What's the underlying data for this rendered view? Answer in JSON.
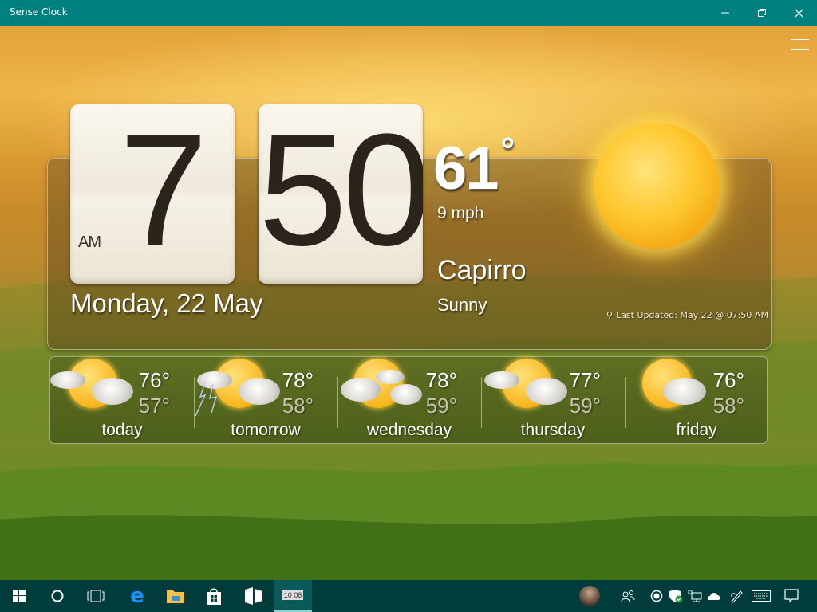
{
  "window": {
    "title": "Sense Clock",
    "minimize_icon": "minimize-icon",
    "maximize_icon": "restore-icon",
    "close_icon": "close-icon"
  },
  "menu": {
    "icon": "hamburger-menu-icon"
  },
  "clock": {
    "hour": "7",
    "minute": "50",
    "ampm": "AM",
    "date": "Monday, 22 May"
  },
  "current_weather": {
    "temperature": "61",
    "degree_symbol": "°",
    "wind": "9 mph",
    "city": "Capirro",
    "condition": "Sunny",
    "condition_icon": "sun-icon",
    "last_updated": "Last Updated: May 22 @ 07:50 AM",
    "location_icon": "location-pin-icon"
  },
  "forecast": [
    {
      "label": "today",
      "high": "76°",
      "low": "57°",
      "icon": "partly-cloudy-icon"
    },
    {
      "label": "tomorrow",
      "high": "78°",
      "low": "58°",
      "icon": "thunderstorm-icon"
    },
    {
      "label": "wednesday",
      "high": "78°",
      "low": "59°",
      "icon": "mostly-cloudy-icon"
    },
    {
      "label": "thursday",
      "high": "77°",
      "low": "59°",
      "icon": "partly-cloudy-icon"
    },
    {
      "label": "friday",
      "high": "76°",
      "low": "58°",
      "icon": "partly-cloudy-icon"
    }
  ],
  "taskbar": {
    "apps": [
      {
        "name": "start",
        "icon": "windows-logo-icon"
      },
      {
        "name": "cortana",
        "icon": "cortana-circle-icon"
      },
      {
        "name": "task-view",
        "icon": "task-view-icon"
      },
      {
        "name": "edge",
        "icon": "edge-browser-icon"
      },
      {
        "name": "file-explorer",
        "icon": "folder-icon"
      },
      {
        "name": "store",
        "icon": "store-bag-icon"
      },
      {
        "name": "app",
        "icon": "app-tiles-icon"
      },
      {
        "name": "sense-clock",
        "icon": "flip-clock-icon",
        "active": true,
        "badge": "10 08"
      }
    ],
    "tray": [
      {
        "name": "user",
        "icon": "user-avatar"
      },
      {
        "name": "people",
        "icon": "people-icon"
      },
      {
        "name": "record",
        "icon": "record-icon"
      },
      {
        "name": "defender",
        "icon": "shield-check-icon"
      },
      {
        "name": "network",
        "icon": "network-icon"
      },
      {
        "name": "onedrive",
        "icon": "cloud-icon"
      },
      {
        "name": "pen",
        "icon": "pen-workspace-icon"
      },
      {
        "name": "keyboard",
        "icon": "keyboard-icon"
      },
      {
        "name": "action-center",
        "icon": "notification-icon"
      }
    ]
  }
}
